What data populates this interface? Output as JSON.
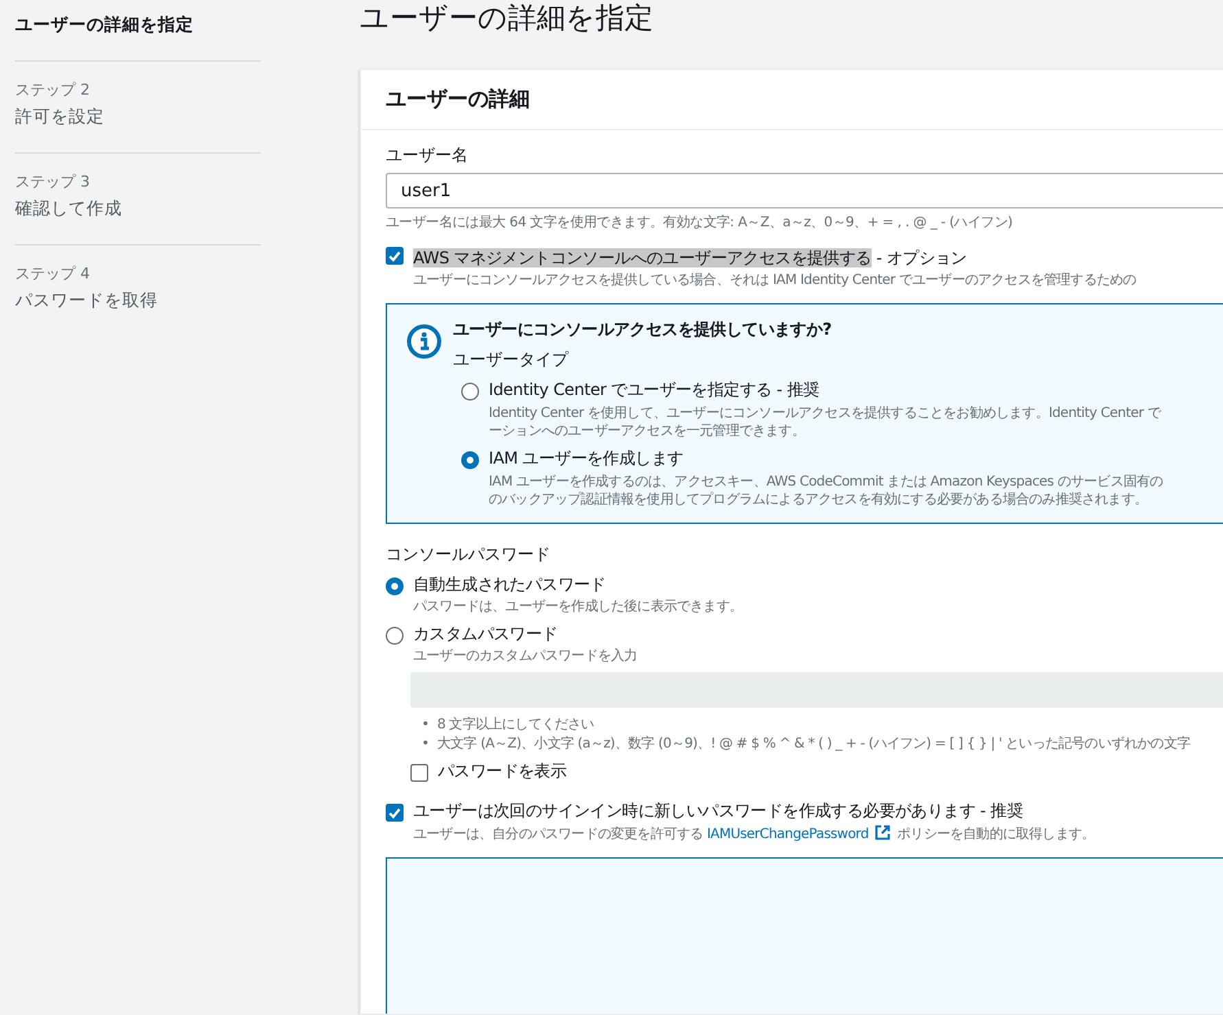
{
  "page_title": "ユーザーの詳細を指定",
  "steps": [
    {
      "title": "ユーザーの詳細を指定",
      "selected": true
    },
    {
      "step": "ステップ 2",
      "title": "許可を設定",
      "selected": false
    },
    {
      "step": "ステップ 3",
      "title": "確認して作成",
      "selected": false
    },
    {
      "step": "ステップ 4",
      "title": "パスワードを取得",
      "selected": false
    }
  ],
  "panel": {
    "title": "ユーザーの詳細",
    "username": {
      "label": "ユーザー名",
      "value": "user1",
      "hint": "ユーザー名には最大 64 文字を使用できます。有効な文字: A～Z、a～z、0～9、+ = , . @ _ - (ハイフン)"
    },
    "console_access": {
      "checked": true,
      "highlighted": true,
      "label": "AWS マネジメントコンソールへのユーザーアクセスを提供する",
      "suffix": " - オプション",
      "description": "ユーザーにコンソールアクセスを提供している場合、それは IAM Identity Center でユーザーのアクセスを管理するための"
    },
    "info": {
      "title": "ユーザーにコンソールアクセスを提供していますか?",
      "group_label": "ユーザータイプ",
      "options": [
        {
          "label": "Identity Center でユーザーを指定する - 推奨",
          "selected": false,
          "lines": [
            "Identity Center を使用して、ユーザーにコンソールアクセスを提供することをお勧めします。Identity Center で",
            "ーションへのユーザーアクセスを一元管理できます。"
          ]
        },
        {
          "label": "IAM ユーザーを作成します",
          "selected": true,
          "lines": [
            "IAM ユーザーを作成するのは、アクセスキー、AWS CodeCommit または Amazon Keyspaces のサービス固有の",
            "のバックアップ認証情報を使用してプログラムによるアクセスを有効にする必要がある場合のみ推奨されます。"
          ]
        }
      ]
    },
    "password": {
      "label": "コンソールパスワード",
      "options": [
        {
          "label": "自動生成されたパスワード",
          "description": "パスワードは、ユーザーを作成した後に表示できます。",
          "selected": true
        },
        {
          "label": "カスタムパスワード",
          "description": "ユーザーのカスタムパスワードを入力",
          "selected": false
        }
      ],
      "rules": [
        {
          "bullet": "•",
          "text": "8 文字以上にしてください"
        },
        {
          "bullet": "•",
          "text": "大文字 (A～Z)、小文字 (a～z)、数字 (0～9)、! @ # $ % ^ & * ( ) _ + - (ハイフン) = [ ] { } | ' といった記号のいずれかの文字"
        }
      ],
      "show_password": {
        "label": "パスワードを表示",
        "checked": false
      }
    },
    "require_reset": {
      "checked": true,
      "label": "ユーザーは次回のサインイン時に新しいパスワードを作成する必要があります - 推奨",
      "description_before": "ユーザーは、自分のパスワードの変更を許可する ",
      "link": "IAMUserChangePassword",
      "description_after": " ポリシーを自動的に取得します。"
    }
  }
}
